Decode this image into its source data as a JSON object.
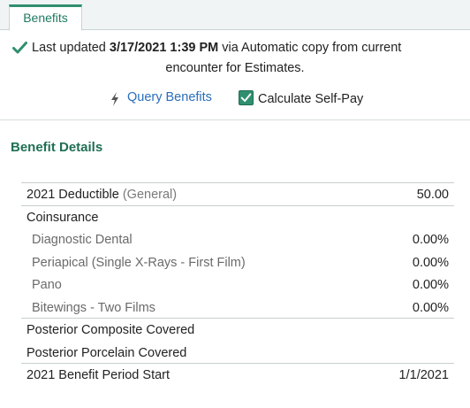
{
  "tab": {
    "label": "Benefits"
  },
  "banner": {
    "prefix": "Last updated ",
    "timestamp": "3/17/2021 1:39 PM",
    "suffix": " via Automatic copy from current",
    "line2": "encounter for Estimates.",
    "query_link": "Query Benefits",
    "self_pay_label": "Calculate Self-Pay",
    "self_pay_checked": true
  },
  "section": {
    "title": "Benefit Details"
  },
  "rows": [
    {
      "label": "2021 Deductible",
      "muted": " (General)",
      "value": "50.00"
    },
    {
      "label": "Coinsurance",
      "value": ""
    },
    {
      "label": "Diagnostic Dental",
      "value": "0.00%"
    },
    {
      "label": "Periapical (Single X-Rays - First Film)",
      "value": "0.00%"
    },
    {
      "label": "Pano",
      "value": "0.00%"
    },
    {
      "label": "Bitewings - Two Films",
      "value": "0.00%"
    },
    {
      "label": "Posterior Composite Covered",
      "value": ""
    },
    {
      "label": "Posterior Porcelain Covered",
      "value": ""
    },
    {
      "label": "2021 Benefit Period Start",
      "value": "1/1/2021"
    }
  ],
  "colors": {
    "accent": "#2f8f6f",
    "link": "#2a6ebb",
    "heading": "#1f6f55"
  }
}
